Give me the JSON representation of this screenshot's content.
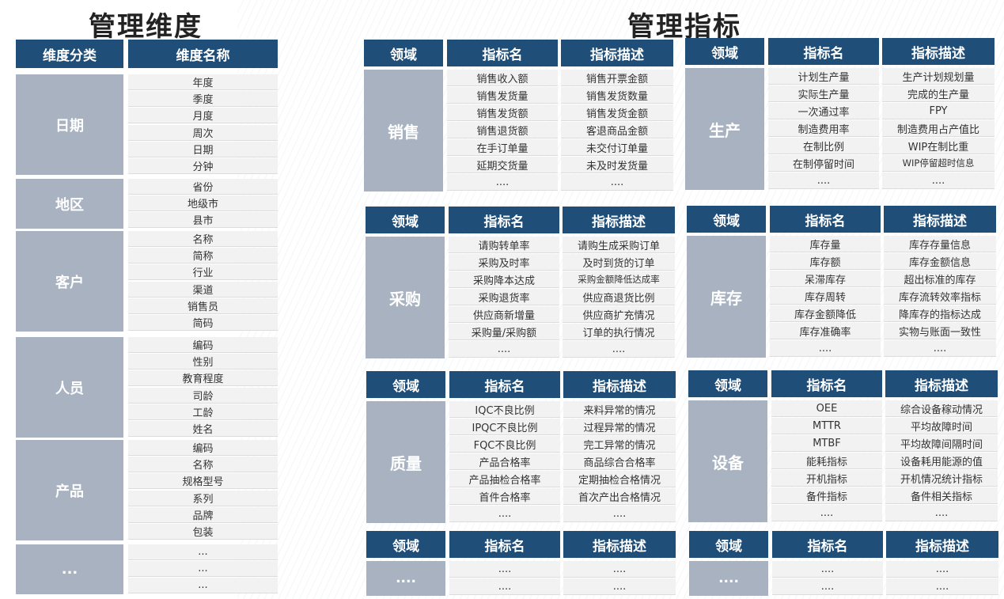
{
  "titles": {
    "left": "管理维度",
    "right": "管理指标"
  },
  "dims": {
    "headers": [
      "维度分类",
      "维度名称"
    ],
    "groups": [
      {
        "cat": "日期",
        "items": [
          "年度",
          "季度",
          "月度",
          "周次",
          "日期",
          "分钟"
        ]
      },
      {
        "cat": "地区",
        "items": [
          "省份",
          "地级市",
          "县市"
        ]
      },
      {
        "cat": "客户",
        "items": [
          "名称",
          "简称",
          "行业",
          "渠道",
          "销售员",
          "简码"
        ]
      },
      {
        "cat": "人员",
        "items": [
          "编码",
          "性别",
          "教育程度",
          "司龄",
          "工龄",
          "姓名"
        ]
      },
      {
        "cat": "产品",
        "items": [
          "编码",
          "名称",
          "规格型号",
          "系列",
          "品牌",
          "包装"
        ]
      },
      {
        "cat": "...",
        "items": [
          "...",
          "...",
          "..."
        ]
      }
    ]
  },
  "indicator_headers": [
    "领域",
    "指标名",
    "指标描述"
  ],
  "panels": [
    {
      "domain": "销售",
      "names": [
        "销售收入额",
        "销售发货量",
        "销售发货额",
        "销售退货额",
        "在手订单量",
        "延期交货量",
        "...."
      ],
      "descs": [
        "销售开票金额",
        "销售发货数量",
        "销售发货金额",
        "客退商品金额",
        "未交付订单量",
        "未及时发货量",
        "...."
      ]
    },
    {
      "domain": "生产",
      "names": [
        "计划生产量",
        "实际生产量",
        "一次通过率",
        "制造费用率",
        "在制比例",
        "在制停留时间",
        "...."
      ],
      "descs": [
        "生产计划规划量",
        "完成的生产量",
        "FPY",
        "制造费用占产值比",
        "WIP在制比重",
        "WIP停留超时信息",
        "...."
      ]
    },
    {
      "domain": "采购",
      "names": [
        "请购转单率",
        "采购及时率",
        "采购降本达成",
        "采购退货率",
        "供应商新增量",
        "采购量/采购额",
        "...."
      ],
      "descs": [
        "请购生成采购订单",
        "及时到货的订单",
        "采购金额降低达成率",
        "供应商退货比例",
        "供应商扩充情况",
        "订单的执行情况",
        "...."
      ]
    },
    {
      "domain": "库存",
      "names": [
        "库存量",
        "库存额",
        "呆滞库存",
        "库存周转",
        "库存金额降低",
        "库存准确率",
        "...."
      ],
      "descs": [
        "库存存量信息",
        "库存金额信息",
        "超出标准的库存",
        "库存流转效率指标",
        "降库存的指标达成",
        "实物与账面一致性",
        "...."
      ]
    },
    {
      "domain": "质量",
      "names": [
        "IQC不良比例",
        "IPQC不良比例",
        "FQC不良比例",
        "产品合格率",
        "产品抽检合格率",
        "首件合格率",
        "...."
      ],
      "descs": [
        "来料异常的情况",
        "过程异常的情况",
        "完工异常的情况",
        "商品综合合格率",
        "定期抽检合格情况",
        "首次产出合格情况",
        "...."
      ]
    },
    {
      "domain": "设备",
      "names": [
        "OEE",
        "MTTR",
        "MTBF",
        "能耗指标",
        "开机指标",
        "备件指标",
        "...."
      ],
      "descs": [
        "综合设备稼动情况",
        "平均故障时间",
        "平均故障间隔时间",
        "设备耗用能源的值",
        "开机情况统计指标",
        "备件相关指标",
        "...."
      ]
    },
    {
      "domain": "....",
      "names": [
        "....",
        "...."
      ],
      "descs": [
        "....",
        "...."
      ]
    },
    {
      "domain": "....",
      "names": [
        "....",
        "...."
      ],
      "descs": [
        "....",
        "...."
      ]
    }
  ]
}
